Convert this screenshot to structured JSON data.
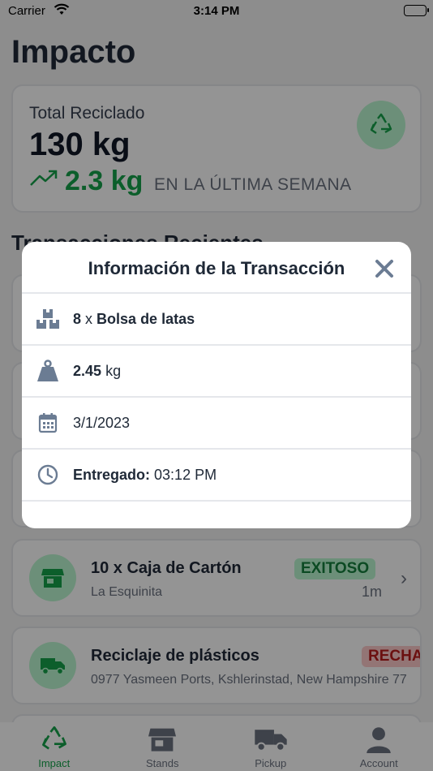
{
  "status": {
    "carrier": "Carrier",
    "time": "3:14 PM"
  },
  "page": {
    "title": "Impacto"
  },
  "summary": {
    "label": "Total Reciclado",
    "total": "130 kg",
    "weekly_value": "2.3 kg",
    "weekly_caption": "EN LA ÚLTIMA SEMANA"
  },
  "section": {
    "title": "Transacciones Recientes"
  },
  "transactions": [
    {
      "title": "10 x Caja de Cartón",
      "subtitle": "La Esquinita",
      "status": "EXITOSO",
      "time": "1m"
    },
    {
      "title": "Reciclaje de plásticos",
      "subtitle": "0977 Yasmeen Ports, Kshlerinstad, New Hampshire 77",
      "status": "RECHAZADO"
    }
  ],
  "tabs": [
    {
      "label": "Impact",
      "icon": "recycle-icon",
      "active": true
    },
    {
      "label": "Stands",
      "icon": "store-icon",
      "active": false
    },
    {
      "label": "Pickup",
      "icon": "truck-icon",
      "active": false
    },
    {
      "label": "Account",
      "icon": "user-icon",
      "active": false
    }
  ],
  "modal": {
    "title": "Información de la Transacción",
    "quantity": "8",
    "separator": "x",
    "item": "Bolsa de latas",
    "weight_value": "2.45",
    "weight_unit": "kg",
    "date": "3/1/2023",
    "delivered_label": "Entregado:",
    "delivered_time": "03:12 PM"
  },
  "colors": {
    "accent_green": "#16a34a",
    "badge_green_bg": "#bbf7d0",
    "icon_gray": "#6b7c93"
  }
}
